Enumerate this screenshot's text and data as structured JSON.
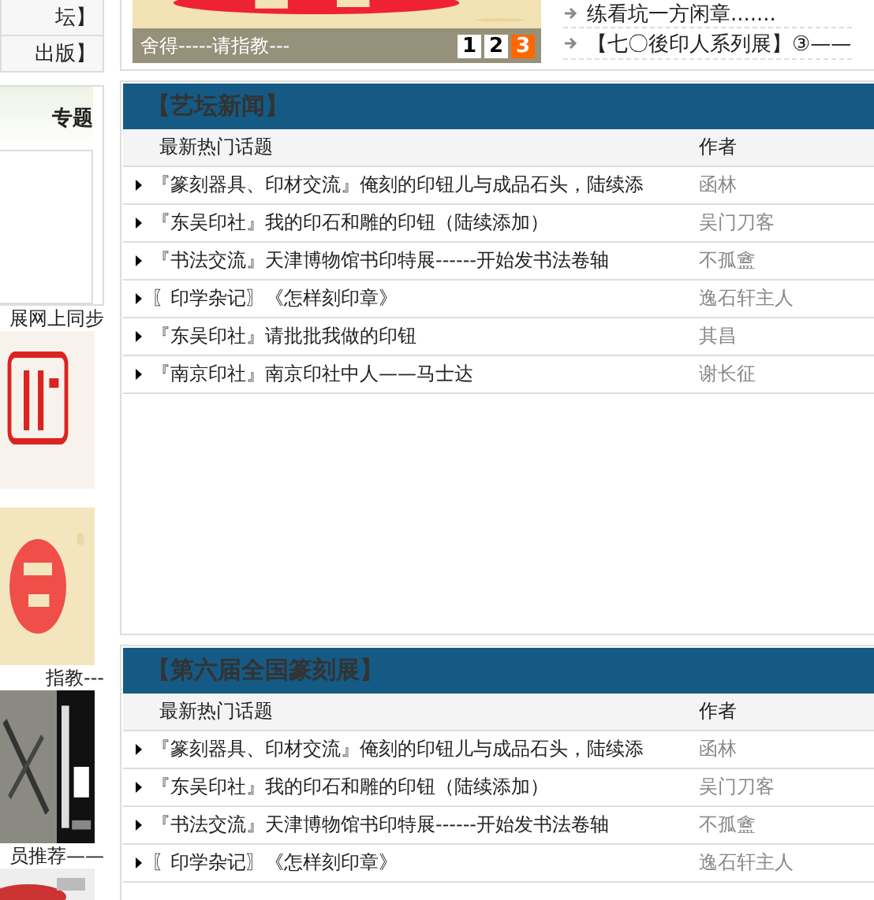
{
  "left": {
    "nav_items": [
      "坛】",
      "出版】"
    ],
    "special": {
      "title": "专题"
    },
    "captions": [
      "展网上同步",
      "指教---",
      "员推荐——"
    ]
  },
  "slider": {
    "caption": "舍得-----请指教---",
    "pages": [
      {
        "label": "1",
        "selected": false
      },
      {
        "label": "2",
        "selected": false
      },
      {
        "label": "3",
        "selected": true
      }
    ]
  },
  "links": [
    "练看坑一方闲章.......",
    "【七〇後印人系列展】③——"
  ],
  "panels": [
    {
      "title": "【艺坛新闻】",
      "columns": [
        "最新热门话题",
        "作者"
      ],
      "rows": [
        {
          "title": "『篆刻器具、印材交流』俺刻的印钮儿与成品石头，陆续添",
          "author": "函林"
        },
        {
          "title": "『东吴印社』我的印石和雕的印钮（陆续添加）",
          "author": "吴门刀客"
        },
        {
          "title": "『书法交流』天津博物馆书印特展------开始发书法卷轴",
          "author": "不孤盦"
        },
        {
          "title": "〖印学杂记〗《怎样刻印章》",
          "author": "逸石轩主人"
        },
        {
          "title": "『东吴印社』请批批我做的印钮",
          "author": "其昌"
        },
        {
          "title": "『南京印社』南京印社中人——马士达",
          "author": "谢长征"
        }
      ]
    },
    {
      "title": "【第六届全国篆刻展】",
      "columns": [
        "最新热门话题",
        "作者"
      ],
      "rows": [
        {
          "title": "『篆刻器具、印材交流』俺刻的印钮儿与成品石头，陆续添",
          "author": "函林"
        },
        {
          "title": "『东吴印社』我的印石和雕的印钮（陆续添加）",
          "author": "吴门刀客"
        },
        {
          "title": "『书法交流』天津博物馆书印特展------开始发书法卷轴",
          "author": "不孤盦"
        },
        {
          "title": "〖印学杂记〗《怎样刻印章》",
          "author": "逸石轩主人"
        }
      ]
    }
  ]
}
